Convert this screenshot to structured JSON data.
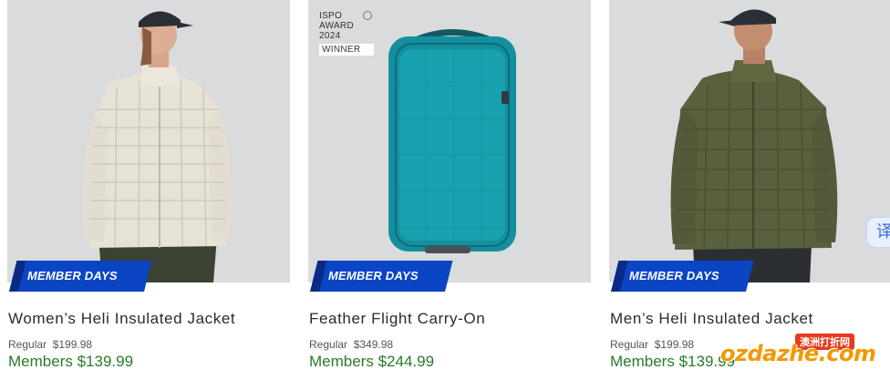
{
  "products": [
    {
      "badge": "MEMBER DAYS",
      "title": "Women’s Heli Insulated Jacket",
      "regular_label": "Regular",
      "regular_price": "$199.98",
      "members_label": "Members",
      "members_price": "$139.99",
      "image": "womens-jacket-cream"
    },
    {
      "badge": "MEMBER DAYS",
      "title": "Feather Flight Carry-On",
      "regular_label": "Regular",
      "regular_price": "$349.98",
      "members_label": "Members",
      "members_price": "$244.99",
      "image": "teal-carry-on-bag",
      "award": {
        "lines": [
          "ISPO",
          "AWARD",
          "2024"
        ],
        "winner": "WINNER"
      }
    },
    {
      "badge": "MEMBER DAYS",
      "title": "Men’s Heli Insulated Jacket",
      "regular_label": "Regular",
      "regular_price": "$199.98",
      "members_label": "Members",
      "members_price": "$139.99",
      "image": "mens-jacket-olive"
    }
  ],
  "translate_tab": {
    "glyph": "译",
    "icon": "translate-icon"
  },
  "watermark": {
    "logo": "ozdazhe.com",
    "tag": "澳洲打折网"
  },
  "colors": {
    "badge_blue": "#0b45c4",
    "member_price_green": "#2a7a2a",
    "image_bg": "#d6d8d9"
  }
}
